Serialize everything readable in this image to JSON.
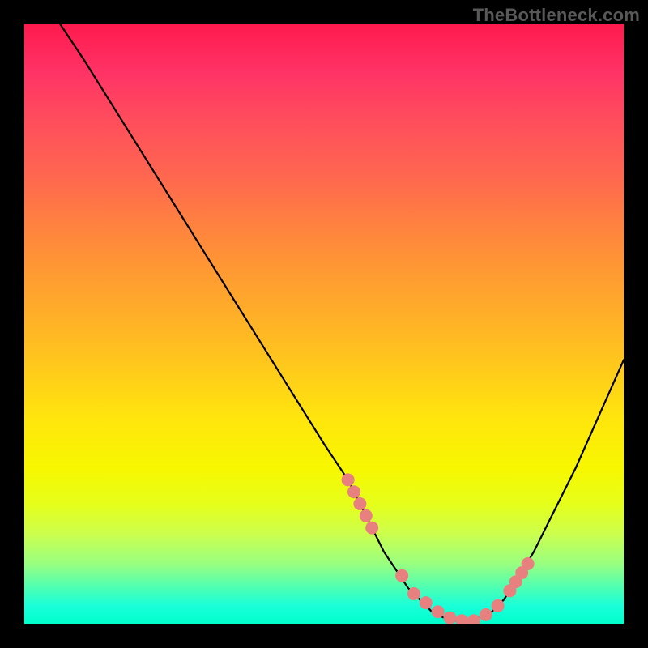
{
  "watermark": "TheBottleneck.com",
  "chart_data": {
    "type": "line",
    "title": "",
    "xlabel": "",
    "ylabel": "",
    "xlim": [
      0,
      100
    ],
    "ylim": [
      0,
      100
    ],
    "gradient_meaning": "bottleneck severity (red = high, green = low)",
    "series": [
      {
        "name": "bottleneck-curve",
        "x": [
          6,
          10,
          15,
          20,
          25,
          30,
          35,
          40,
          45,
          50,
          54,
          55,
          56,
          58,
          60,
          62,
          64,
          66,
          68,
          70,
          72,
          74,
          76,
          78,
          80,
          82,
          85,
          88,
          92,
          96,
          100
        ],
        "values": [
          100,
          94,
          86,
          78,
          70,
          62,
          54,
          46,
          38,
          30,
          24,
          22,
          20,
          16,
          12,
          9,
          6,
          4,
          2,
          1,
          0.5,
          0.5,
          1,
          2,
          4,
          7,
          12,
          18,
          26,
          35,
          44
        ]
      }
    ],
    "highlight_markers": {
      "name": "sweet-spot-markers",
      "x": [
        54,
        55,
        56,
        57,
        58,
        63,
        65,
        67,
        69,
        71,
        73,
        75,
        77,
        79,
        81,
        82,
        83,
        84
      ],
      "values": [
        24,
        22,
        20,
        18,
        16,
        8,
        5,
        3.5,
        2,
        1,
        0.5,
        0.5,
        1.5,
        3,
        5.5,
        7,
        8.5,
        10
      ]
    }
  }
}
